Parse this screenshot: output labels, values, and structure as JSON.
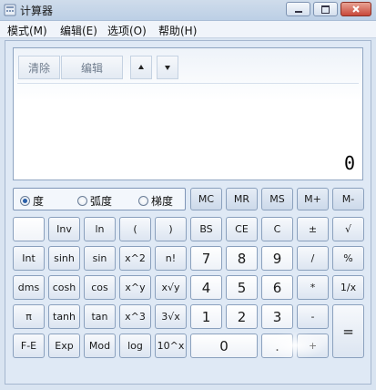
{
  "window": {
    "title": "计算器"
  },
  "menu": {
    "mode": "模式(M)",
    "edit": "编辑(E)",
    "options": "选项(O)",
    "help": "帮助(H)"
  },
  "display": {
    "clear_label": "清除",
    "edit_label": "编辑",
    "value": "0"
  },
  "angle": {
    "degrees": "度",
    "radians": "弧度",
    "gradians": "梯度",
    "selected": "度"
  },
  "memory": [
    "MC",
    "MR",
    "MS",
    "M+",
    "M-"
  ],
  "sci_rows": [
    [
      "",
      "Inv",
      "ln",
      "(",
      ")"
    ],
    [
      "Int",
      "sinh",
      "sin",
      "x^2",
      "n!"
    ],
    [
      "dms",
      "cosh",
      "cos",
      "x^y",
      "x√y"
    ],
    [
      "π",
      "tanh",
      "tan",
      "x^3",
      "3√x"
    ],
    [
      "F-E",
      "Exp",
      "Mod",
      "log",
      "10^x"
    ]
  ],
  "std_rows": [
    [
      "BS",
      "CE",
      "C",
      "±",
      "√"
    ],
    [
      "7",
      "8",
      "9",
      "/",
      "%"
    ],
    [
      "4",
      "5",
      "6",
      "*",
      "1/x"
    ],
    [
      "1",
      "2",
      "3",
      "-"
    ],
    [
      "0",
      "."
    ]
  ],
  "equals": "=",
  "plus": "+"
}
